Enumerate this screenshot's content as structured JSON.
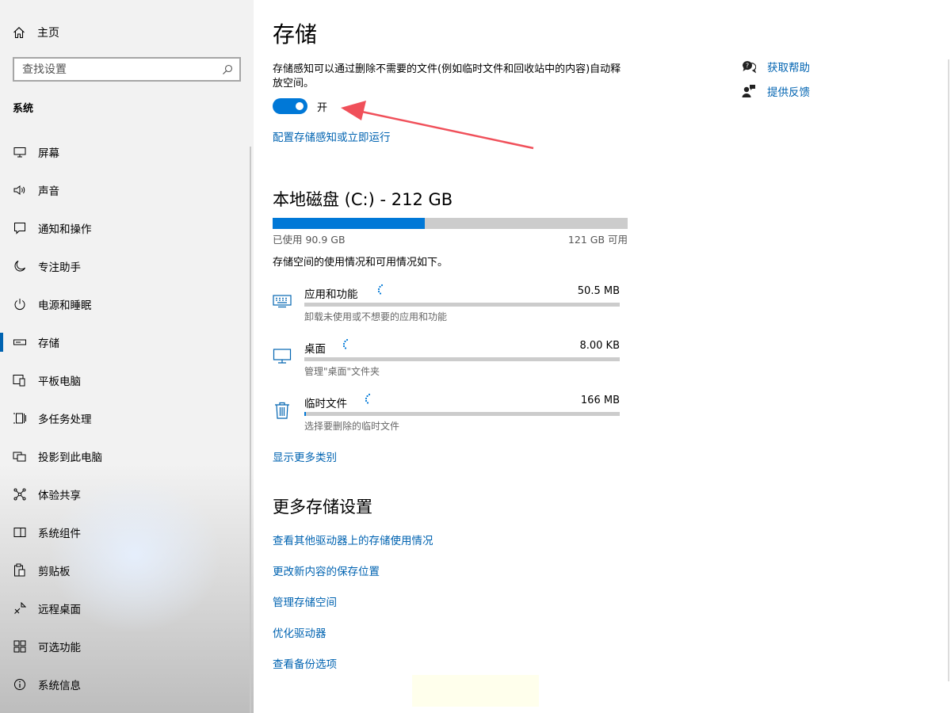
{
  "sidebar": {
    "home_label": "主页",
    "search_placeholder": "查找设置",
    "section_label": "系统",
    "items": [
      {
        "label": "屏幕",
        "icon": "monitor-icon"
      },
      {
        "label": "声音",
        "icon": "speaker-icon"
      },
      {
        "label": "通知和操作",
        "icon": "message-icon"
      },
      {
        "label": "专注助手",
        "icon": "moon-icon"
      },
      {
        "label": "电源和睡眠",
        "icon": "power-icon"
      },
      {
        "label": "存储",
        "icon": "storage-icon",
        "selected": true
      },
      {
        "label": "平板电脑",
        "icon": "tablet-icon"
      },
      {
        "label": "多任务处理",
        "icon": "multitask-icon"
      },
      {
        "label": "投影到此电脑",
        "icon": "project-icon"
      },
      {
        "label": "体验共享",
        "icon": "share-icon"
      },
      {
        "label": "系统组件",
        "icon": "component-icon"
      },
      {
        "label": "剪贴板",
        "icon": "clipboard-icon"
      },
      {
        "label": "远程桌面",
        "icon": "remote-icon"
      },
      {
        "label": "可选功能",
        "icon": "grid-icon"
      },
      {
        "label": "系统信息",
        "icon": "info-icon"
      }
    ]
  },
  "main": {
    "title": "存储",
    "description": "存储感知可以通过删除不需要的文件(例如临时文件和回收站中的内容)自动释放空间。",
    "toggle_label": "开",
    "configure_link": "配置存储感知或立即运行",
    "disk": {
      "title": "本地磁盘 (C:) - 212 GB",
      "used_label": "已使用 90.9 GB",
      "free_label": "121 GB 可用",
      "used_fraction": 0.429
    },
    "usage_intro": "存储空间的使用情况和可用情况如下。",
    "categories": [
      {
        "name": "应用和功能",
        "size": "50.5 MB",
        "sub": "卸载未使用或不想要的应用和功能",
        "fraction": 0.0,
        "icon": "keyboard-icon"
      },
      {
        "name": "桌面",
        "size": "8.00 KB",
        "sub": "管理\"桌面\"文件夹",
        "fraction": 0.0,
        "icon": "desktop-icon"
      },
      {
        "name": "临时文件",
        "size": "166 MB",
        "sub": "选择要删除的临时文件",
        "fraction": 0.004,
        "icon": "trash-icon"
      }
    ],
    "show_more": "显示更多类别",
    "more_title": "更多存储设置",
    "more_links": [
      "查看其他驱动器上的存储使用情况",
      "更改新内容的保存位置",
      "管理存储空间",
      "优化驱动器",
      "查看备份选项"
    ]
  },
  "help": {
    "get_help": "获取帮助",
    "feedback": "提供反馈"
  },
  "colors": {
    "accent": "#0078d7",
    "link": "#0063b1",
    "annotation_arrow": "#f0505a"
  }
}
